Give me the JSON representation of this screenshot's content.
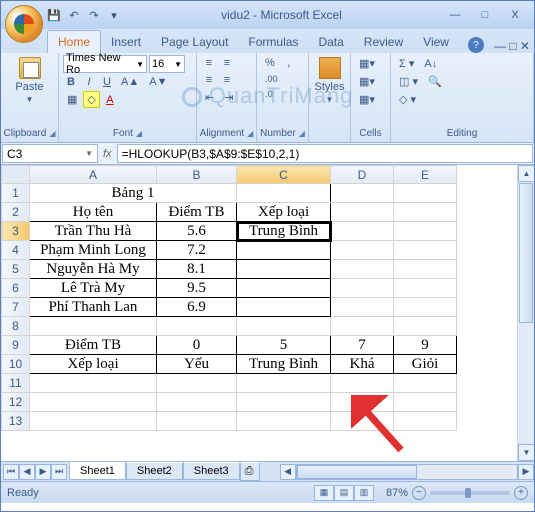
{
  "window": {
    "title": "vidu2 - Microsoft Excel",
    "controls": {
      "min": "—",
      "max": "□",
      "close": "X"
    }
  },
  "qat": {
    "save": "💾",
    "undo": "↶",
    "redo": "↷",
    "more": "▾"
  },
  "tabs": [
    "Home",
    "Insert",
    "Page Layout",
    "Formulas",
    "Data",
    "Review",
    "View"
  ],
  "active_tab": "Home",
  "ribbon": {
    "clipboard": {
      "paste": "Paste",
      "label": "Clipboard"
    },
    "font": {
      "family": "Times New Ro",
      "size": "16",
      "bold": "B",
      "italic": "I",
      "underline": "U",
      "border": "▦",
      "fill": "◇",
      "color": "A",
      "label": "Font"
    },
    "alignment": {
      "label": "Alignment"
    },
    "number": {
      "label": "Number",
      "pct": "%",
      "comma": ",",
      "dec1": "◅.0",
      "dec2": ".00▻"
    },
    "styles": {
      "label": "Styles"
    },
    "cells": {
      "label": "Cells",
      "insert": "▥",
      "delete": "▤",
      "format": "▦"
    },
    "editing": {
      "label": "Editing",
      "sigma": "Σ ▾",
      "fill": "◫ ▾",
      "clear": "◇ ▾",
      "sort": "A↓",
      "find": "🔍"
    }
  },
  "namebox": "C3",
  "formula": "=HLOOKUP(B3,$A$9:$E$10,2,1)",
  "columns": [
    "A",
    "B",
    "C",
    "D",
    "E"
  ],
  "rows": [
    "1",
    "2",
    "3",
    "4",
    "5",
    "6",
    "7",
    "8",
    "9",
    "10",
    "11",
    "12",
    "13"
  ],
  "cells": {
    "r1": {
      "a": "Bảng 1"
    },
    "r2": {
      "a": "Họ tên",
      "b": "Điểm TB",
      "c": "Xếp loại"
    },
    "r3": {
      "a": "Trần Thu Hà",
      "b": "5.6",
      "c": "Trung Bình"
    },
    "r4": {
      "a": "Phạm Minh Long",
      "b": "7.2"
    },
    "r5": {
      "a": "Nguyễn Hà My",
      "b": "8.1"
    },
    "r6": {
      "a": "Lê Trà My",
      "b": "9.5"
    },
    "r7": {
      "a": "Phí Thanh Lan",
      "b": "6.9"
    },
    "r9": {
      "a": "Điểm TB",
      "b": "0",
      "c": "5",
      "d": "7",
      "e": "9"
    },
    "r10": {
      "a": "Xếp loại",
      "b": "Yếu",
      "c": "Trung Bình",
      "d": "Khá",
      "e": "Giỏi"
    }
  },
  "sheets": [
    "Sheet1",
    "Sheet2",
    "Sheet3"
  ],
  "active_sheet": "Sheet1",
  "status": {
    "ready": "Ready",
    "zoom": "87%"
  },
  "watermark": "QuanTriMang"
}
